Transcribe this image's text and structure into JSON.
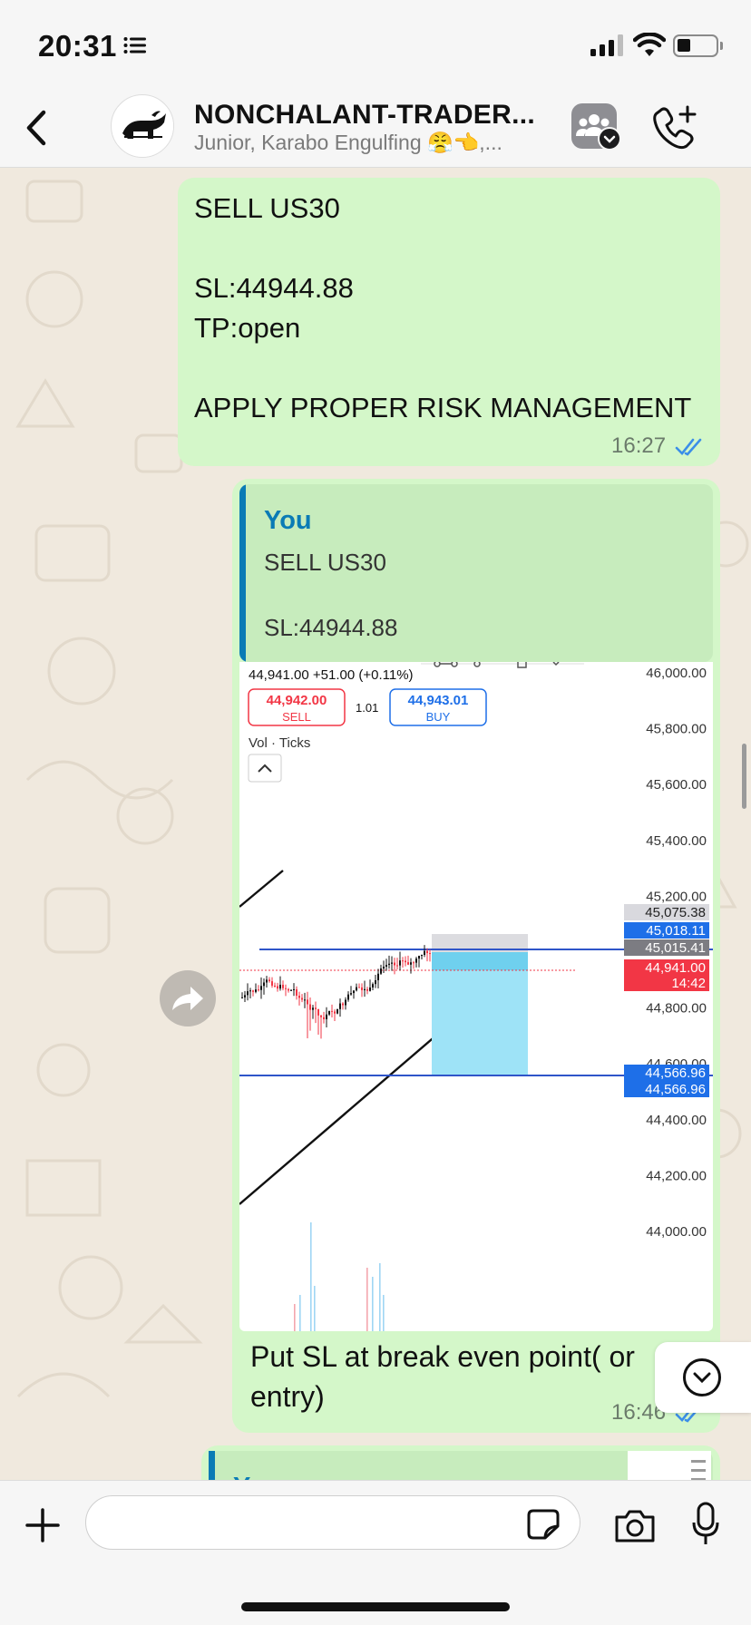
{
  "status": {
    "time": "20:31"
  },
  "header": {
    "title": "NONCHALANT-TRADER...",
    "subtitle": "Junior, Karabo Engulfing 😤👈,..."
  },
  "messages": [
    {
      "text": "SELL US30\n\nSL:44944.88\nTP:open\n\nAPPLY PROPER RISK MANAGEMENT",
      "time": "16:27"
    },
    {
      "quote_author": "You",
      "quote_text": "SELL US30\n\nSL:44944.88",
      "caption": "Put SL at break even point( or entry)",
      "time": "16:46"
    },
    {
      "quote_author": "You"
    }
  ],
  "chart_panel": {
    "header_text": "44,941.00 +51.00 (+0.11%)",
    "sell_price": "44,942.00",
    "sell_label": "SELL",
    "spread": "1.01",
    "buy_price": "44,943.01",
    "buy_label": "BUY",
    "indicator": "Vol · Ticks",
    "price_ticks": [
      "46,000.00",
      "45,800.00",
      "45,600.00",
      "45,400.00",
      "45,200.00",
      "44,800.00",
      "44,600.00",
      "44,400.00",
      "44,200.00",
      "44,000.00"
    ],
    "price_labels": [
      {
        "text": "45,075.38",
        "color": "#d9d9de",
        "text_color": "#222"
      },
      {
        "text": "45,018.11",
        "color": "#1e6fe8",
        "text_color": "#fff"
      },
      {
        "text": "45,015.41",
        "color": "#7c7c82",
        "text_color": "#fff"
      },
      {
        "text": "44,941.00",
        "color": "#f23645",
        "text_color": "#fff"
      },
      {
        "text": "14:42",
        "color": "#f23645",
        "text_color": "#fff"
      },
      {
        "text": "44,566.96",
        "color": "#1e6fe8",
        "text_color": "#fff"
      },
      {
        "text": "44,566.96",
        "color": "#1e6fe8",
        "text_color": "#fff"
      }
    ],
    "colors": {
      "sell": "#f23645",
      "buy": "#1e6fe8",
      "tp_zone": "#9ee3f7",
      "sl_zone": "#dcdce0",
      "line": "#2f55c9"
    }
  },
  "icons": [
    "list-icon",
    "signal-icon",
    "wifi-icon",
    "battery-icon",
    "back-chevron-icon",
    "community-icon",
    "add-call-icon",
    "forward-icon",
    "chevron-down-icon",
    "plus-icon",
    "sticker-icon",
    "camera-icon",
    "microphone-icon",
    "double-check-icon"
  ]
}
